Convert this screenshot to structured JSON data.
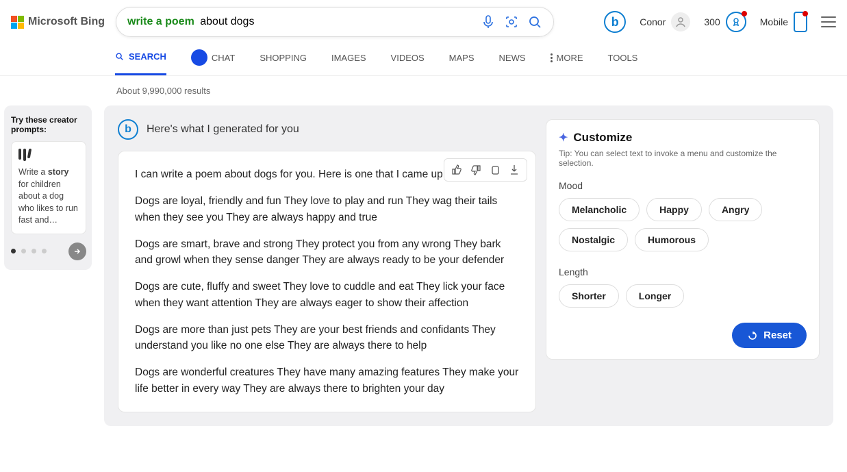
{
  "logo": "Microsoft Bing",
  "search": {
    "prefix": "write a poem",
    "suffix": " about dogs"
  },
  "user": {
    "name": "Conor"
  },
  "points": "300",
  "mobile_label": "Mobile",
  "tabs": [
    "SEARCH",
    "CHAT",
    "SHOPPING",
    "IMAGES",
    "VIDEOS",
    "MAPS",
    "NEWS",
    "MORE",
    "TOOLS"
  ],
  "result_count": "About 9,990,000 results",
  "creator": {
    "title": "Try these creator prompts:",
    "card_pre": "Write a ",
    "card_bold": "story",
    "card_post": " for children about a dog who likes to run fast and…"
  },
  "gen_title": "Here's what I generated for you",
  "poem": {
    "intro": "I can write a poem about dogs for you. Here is one that I came up with:",
    "s1": "Dogs are loyal, friendly and fun They love to play and run They wag their tails when they see you They are always happy and true",
    "s2": "Dogs are smart, brave and strong They protect you from any wrong They bark and growl when they sense danger They are always ready to be your defender",
    "s3": "Dogs are cute, fluffy and sweet They love to cuddle and eat They lick your face when they want attention They are always eager to show their affection",
    "s4": "Dogs are more than just pets They are your best friends and confidants They understand you like no one else They are always there to help",
    "s5": "Dogs are wonderful creatures They have many amazing features They make your life better in every way They are always there to brighten your day"
  },
  "customize": {
    "title": "Customize",
    "tip": "Tip: You can select text to invoke a menu and customize the selection.",
    "mood_label": "Mood",
    "moods": [
      "Melancholic",
      "Happy",
      "Angry",
      "Nostalgic",
      "Humorous"
    ],
    "length_label": "Length",
    "lengths": [
      "Shorter",
      "Longer"
    ],
    "reset": "Reset"
  }
}
